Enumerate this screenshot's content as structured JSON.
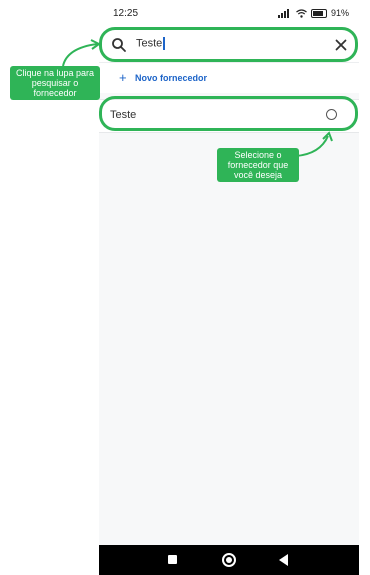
{
  "status_bar": {
    "time": "12:25",
    "battery": "91%"
  },
  "search": {
    "value": "Teste"
  },
  "actions": {
    "new_supplier": "Novo fornecedor"
  },
  "suppliers": [
    {
      "name": "Teste",
      "selected": false
    }
  ],
  "annotations": {
    "search_tip": "Clique na lupa para pesquisar o fornecedor",
    "select_tip": "Selecione o fornecedor que você deseja"
  },
  "colors": {
    "accent": "#1d64c8",
    "annotation_green": "#2fb457"
  }
}
